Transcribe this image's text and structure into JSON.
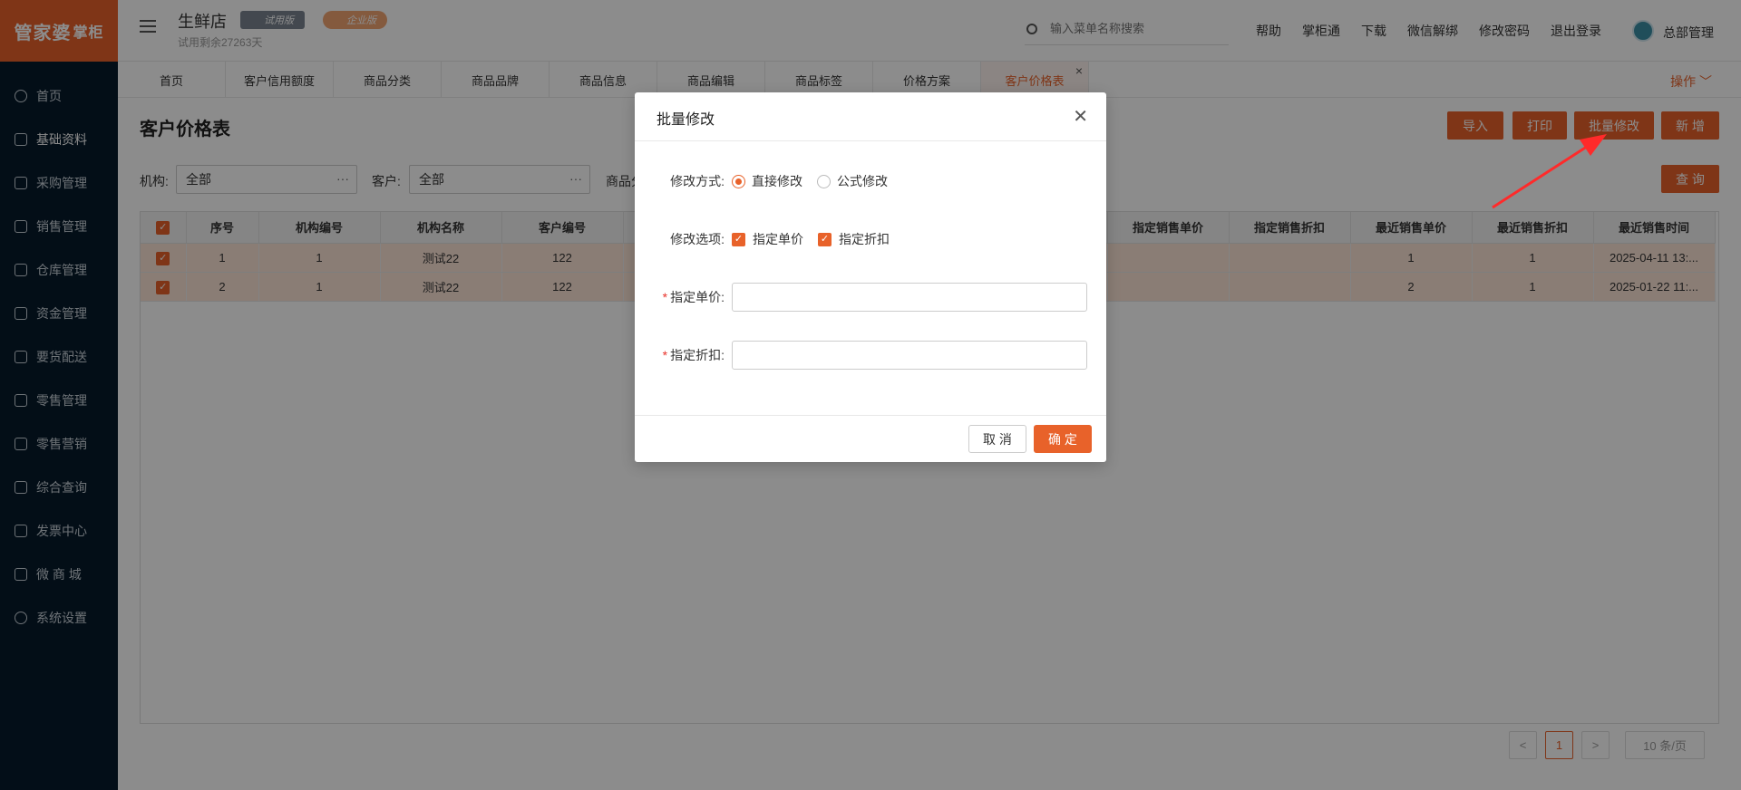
{
  "brand": {
    "logo_main": "管家婆",
    "logo_sub": "掌柜",
    "accent": "#e8622a"
  },
  "sidebar": {
    "items": [
      {
        "label": "首页"
      },
      {
        "label": "基础资料"
      },
      {
        "label": "采购管理"
      },
      {
        "label": "销售管理"
      },
      {
        "label": "仓库管理"
      },
      {
        "label": "资金管理"
      },
      {
        "label": "要货配送"
      },
      {
        "label": "零售管理"
      },
      {
        "label": "零售营销"
      },
      {
        "label": "综合查询"
      },
      {
        "label": "发票中心"
      },
      {
        "label": "微 商 城"
      },
      {
        "label": "系统设置"
      }
    ]
  },
  "header": {
    "shop_name": "生鲜店",
    "trial_text": "试用剩余27263天",
    "badge_trial": "试用版",
    "badge_edition": "企业版",
    "search_placeholder": "输入菜单名称搜索",
    "links": [
      "帮助",
      "掌柜通",
      "下载",
      "微信解绑",
      "修改密码",
      "退出登录"
    ],
    "user": "总部管理"
  },
  "tabs": [
    "首页",
    "客户信用额度",
    "商品分类",
    "商品品牌",
    "商品信息",
    "商品编辑",
    "商品标签",
    "价格方案",
    "客户价格表"
  ],
  "tab_ops": "操作",
  "page": {
    "title": "客户价格表",
    "buttons": {
      "import": "导入",
      "print": "打印",
      "batch_edit": "批量修改",
      "add": "新 增",
      "query": "查 询"
    },
    "filters": {
      "org_label": "机构:",
      "org_value": "全部",
      "cust_label": "客户:",
      "cust_value": "全部",
      "goods_label": "商品分"
    }
  },
  "table": {
    "headers": [
      "序号",
      "机构编号",
      "机构名称",
      "客户编号",
      "指定销售单价",
      "指定销售折扣",
      "最近销售单价",
      "最近销售折扣",
      "最近销售时间"
    ],
    "rows": [
      {
        "seq": "1",
        "org_no": "1",
        "org_name": "测试22",
        "cust_no": "122",
        "set_price": "",
        "set_disc": "",
        "last_price": "1",
        "last_disc": "1",
        "last_time": "2025-04-11 13:..."
      },
      {
        "seq": "2",
        "org_no": "1",
        "org_name": "测试22",
        "cust_no": "122",
        "set_price": "",
        "set_disc": "",
        "last_price": "2",
        "last_disc": "1",
        "last_time": "2025-01-22 11:..."
      }
    ]
  },
  "pagination": {
    "prev": "<",
    "current": "1",
    "next": ">",
    "page_size": "10 条/页"
  },
  "modal": {
    "title": "批量修改",
    "mode_label": "修改方式:",
    "mode_options": [
      "直接修改",
      "公式修改"
    ],
    "mode_selected": "直接修改",
    "option_label": "修改选项:",
    "option_items": [
      "指定单价",
      "指定折扣"
    ],
    "price_label": "指定单价:",
    "discount_label": "指定折扣:",
    "cancel": "取 消",
    "ok": "确 定"
  }
}
